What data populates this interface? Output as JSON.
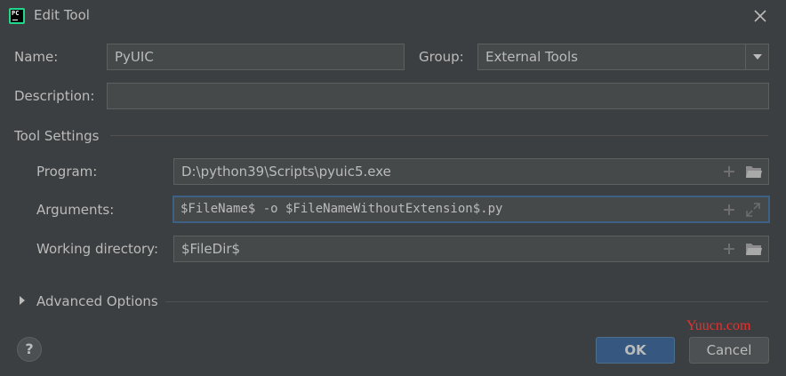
{
  "window": {
    "title": "Edit Tool",
    "app_icon_text": "PC"
  },
  "form": {
    "name_label": "Name:",
    "name_value": "PyUIC",
    "group_label": "Group:",
    "group_value": "External Tools",
    "description_label": "Description:",
    "description_value": ""
  },
  "tool_settings": {
    "header": "Tool Settings",
    "program_label": "Program:",
    "program_value": "D:\\python39\\Scripts\\pyuic5.exe",
    "arguments_label": "Arguments:",
    "arguments_value": "$FileName$ -o $FileNameWithoutExtension$.py",
    "workdir_label": "Working directory:",
    "workdir_value": "$FileDir$"
  },
  "advanced": {
    "label": "Advanced Options"
  },
  "footer": {
    "help_label": "?",
    "ok_label": "OK",
    "cancel_label": "Cancel",
    "watermark": "Yuucn.com"
  },
  "icons": {
    "close": "close-icon",
    "add": "plus-icon",
    "folder": "folder-icon",
    "expand": "expand-icon",
    "dropdown": "chevron-down-icon",
    "disclosure": "triangle-right-icon"
  },
  "colors": {
    "background": "#3c3f41",
    "field_bg": "#45494a",
    "focus_border": "#3d6185",
    "ok_button": "#365880",
    "watermark": "#e8312f"
  }
}
